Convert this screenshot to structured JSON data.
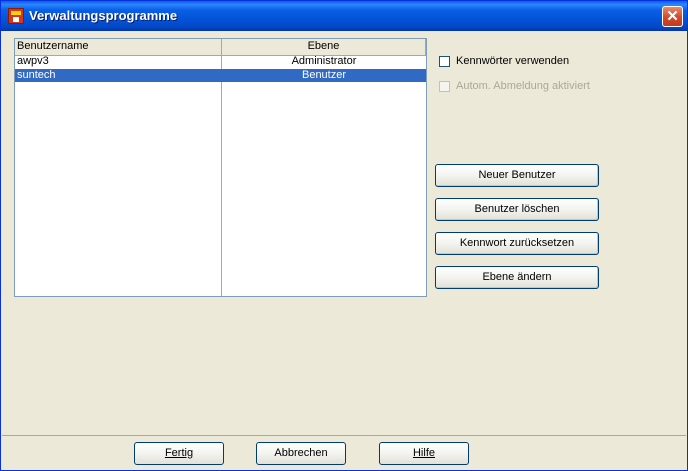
{
  "window": {
    "title": "Verwaltungsprogramme"
  },
  "list": {
    "columns": [
      "Benutzername",
      "Ebene"
    ],
    "rows": [
      {
        "name": "awpv3",
        "level": "Administrator",
        "selected": false
      },
      {
        "name": "suntech",
        "level": "Benutzer",
        "selected": true
      }
    ]
  },
  "options": {
    "use_passwords": {
      "label": "Kennwörter verwenden",
      "checked": false,
      "enabled": true
    },
    "auto_logout": {
      "label": "Autom. Abmeldung aktiviert",
      "checked": false,
      "enabled": false
    }
  },
  "buttons": {
    "new_user": "Neuer Benutzer",
    "delete_user": "Benutzer löschen",
    "reset_password": "Kennwort zurücksetzen",
    "change_level": "Ebene ändern"
  },
  "footer": {
    "done": "Fertig",
    "cancel": "Abbrechen",
    "help": "Hilfe"
  },
  "colors": {
    "title_bar": "#0a5fe5",
    "selection": "#316ac5",
    "close": "#d2492a"
  }
}
